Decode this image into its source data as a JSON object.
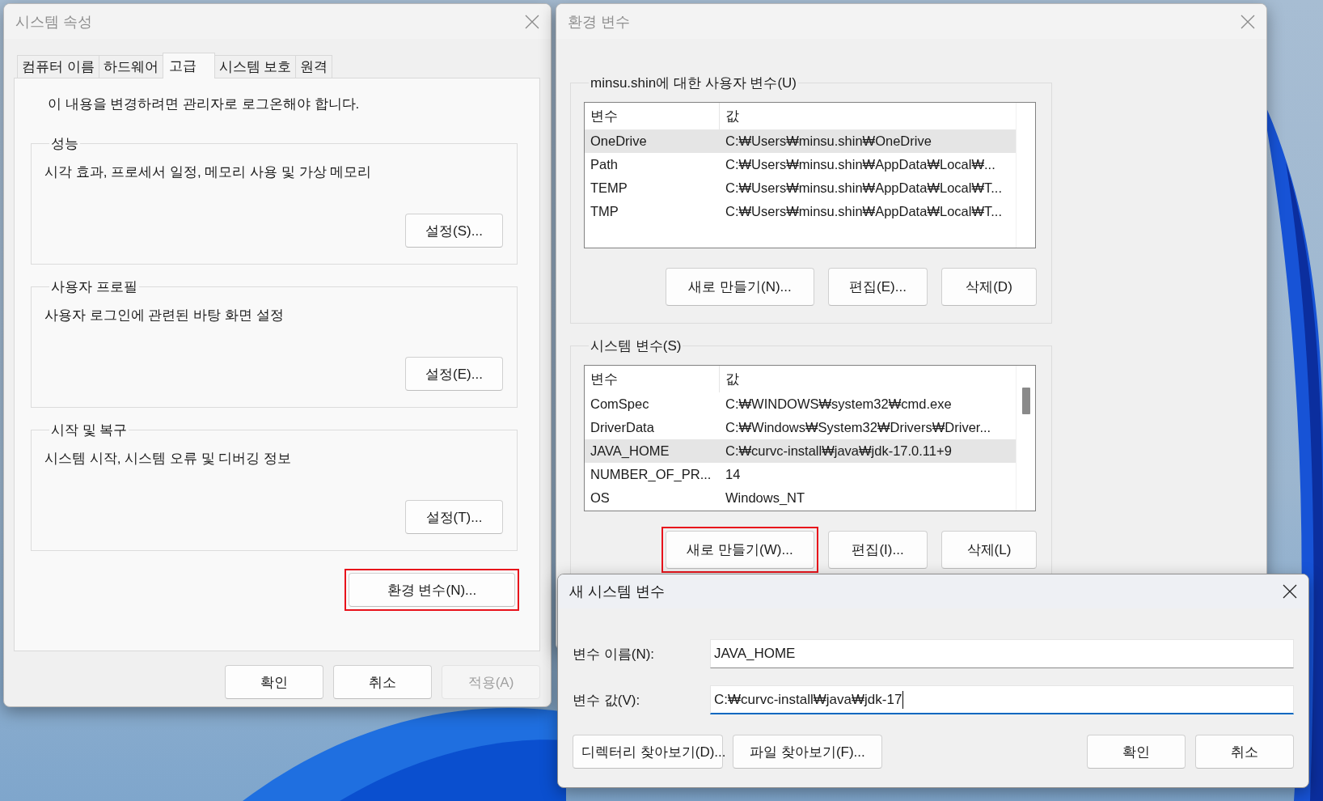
{
  "system_properties": {
    "title": "시스템 속성",
    "active": false,
    "tabs": [
      {
        "label": "컴퓨터 이름",
        "selected": false
      },
      {
        "label": "하드웨어",
        "selected": false
      },
      {
        "label": "고급",
        "selected": true
      },
      {
        "label": "시스템 보호",
        "selected": false
      },
      {
        "label": "원격",
        "selected": false
      }
    ],
    "notice": "이 내용을 변경하려면 관리자로 로그온해야 합니다.",
    "groups": [
      {
        "title": "성능",
        "description": "시각 효과, 프로세서 일정, 메모리 사용 및 가상 메모리",
        "button": "설정(S)..."
      },
      {
        "title": "사용자 프로필",
        "description": "사용자 로그인에 관련된 바탕 화면 설정",
        "button": "설정(E)..."
      },
      {
        "title": "시작 및 복구",
        "description": "시스템 시작, 시스템 오류 및 디버깅 정보",
        "button": "설정(T)..."
      }
    ],
    "env_button": {
      "label": "환경 변수(N)...",
      "highlighted": true
    },
    "buttons": [
      {
        "label": "확인",
        "disabled": false
      },
      {
        "label": "취소",
        "disabled": false
      },
      {
        "label": "적용(A)",
        "disabled": true
      }
    ]
  },
  "environment_variables": {
    "title": "환경 변수",
    "active": false,
    "user_variables": {
      "title": "minsu.shin에 대한 사용자 변수(U)",
      "columns": [
        "변수",
        "값"
      ],
      "rows": [
        {
          "name": "OneDrive",
          "value": "C:₩Users₩minsu.shin₩OneDrive",
          "selected": true
        },
        {
          "name": "Path",
          "value": "C:₩Users₩minsu.shin₩AppData₩Local₩...",
          "selected": false
        },
        {
          "name": "TEMP",
          "value": "C:₩Users₩minsu.shin₩AppData₩Local₩T...",
          "selected": false
        },
        {
          "name": "TMP",
          "value": "C:₩Users₩minsu.shin₩AppData₩Local₩T...",
          "selected": false
        }
      ],
      "buttons": [
        {
          "label": "새로 만들기(N)...",
          "highlighted": false
        },
        {
          "label": "편집(E)...",
          "highlighted": false
        },
        {
          "label": "삭제(D)",
          "highlighted": false
        }
      ]
    },
    "system_variables": {
      "title": "시스템 변수(S)",
      "columns": [
        "변수",
        "값"
      ],
      "rows": [
        {
          "name": "ComSpec",
          "value": "C:₩WINDOWS₩system32₩cmd.exe",
          "selected": false
        },
        {
          "name": "DriverData",
          "value": "C:₩Windows₩System32₩Drivers₩Driver...",
          "selected": false
        },
        {
          "name": "JAVA_HOME",
          "value": "C:₩curvc-install₩java₩jdk-17.0.11+9",
          "selected": true
        },
        {
          "name": "NUMBER_OF_PR...",
          "value": "14",
          "selected": false
        },
        {
          "name": "OS",
          "value": "Windows_NT",
          "selected": false
        }
      ],
      "buttons": [
        {
          "label": "새로 만들기(W)...",
          "highlighted": true
        },
        {
          "label": "편집(I)...",
          "highlighted": false
        },
        {
          "label": "삭제(L)",
          "highlighted": false
        }
      ]
    }
  },
  "new_system_variable": {
    "title": "새 시스템 변수",
    "active": true,
    "fields": [
      {
        "label": "변수 이름(N):",
        "value": "JAVA_HOME",
        "focused": false
      },
      {
        "label": "변수 값(V):",
        "value": "C:₩curvc-install₩java₩jdk-17",
        "focused": true
      }
    ],
    "buttons": [
      {
        "label": "디렉터리 찾아보기(D)..."
      },
      {
        "label": "파일 찾아보기(F)..."
      },
      {
        "label": "확인"
      },
      {
        "label": "취소"
      }
    ]
  }
}
